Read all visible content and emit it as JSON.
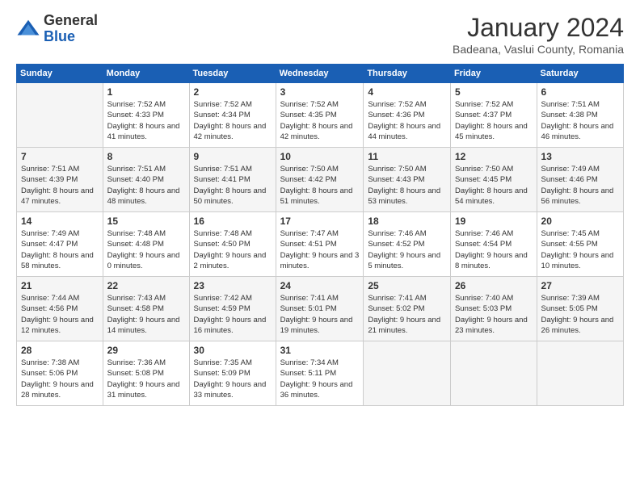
{
  "header": {
    "logo": {
      "general": "General",
      "blue": "Blue"
    },
    "title": "January 2024",
    "location": "Badeana, Vaslui County, Romania"
  },
  "weekdays": [
    "Sunday",
    "Monday",
    "Tuesday",
    "Wednesday",
    "Thursday",
    "Friday",
    "Saturday"
  ],
  "weeks": [
    [
      {
        "day": "",
        "sunrise": "",
        "sunset": "",
        "daylight": ""
      },
      {
        "day": "1",
        "sunrise": "Sunrise: 7:52 AM",
        "sunset": "Sunset: 4:33 PM",
        "daylight": "Daylight: 8 hours and 41 minutes."
      },
      {
        "day": "2",
        "sunrise": "Sunrise: 7:52 AM",
        "sunset": "Sunset: 4:34 PM",
        "daylight": "Daylight: 8 hours and 42 minutes."
      },
      {
        "day": "3",
        "sunrise": "Sunrise: 7:52 AM",
        "sunset": "Sunset: 4:35 PM",
        "daylight": "Daylight: 8 hours and 42 minutes."
      },
      {
        "day": "4",
        "sunrise": "Sunrise: 7:52 AM",
        "sunset": "Sunset: 4:36 PM",
        "daylight": "Daylight: 8 hours and 44 minutes."
      },
      {
        "day": "5",
        "sunrise": "Sunrise: 7:52 AM",
        "sunset": "Sunset: 4:37 PM",
        "daylight": "Daylight: 8 hours and 45 minutes."
      },
      {
        "day": "6",
        "sunrise": "Sunrise: 7:51 AM",
        "sunset": "Sunset: 4:38 PM",
        "daylight": "Daylight: 8 hours and 46 minutes."
      }
    ],
    [
      {
        "day": "7",
        "sunrise": "Sunrise: 7:51 AM",
        "sunset": "Sunset: 4:39 PM",
        "daylight": "Daylight: 8 hours and 47 minutes."
      },
      {
        "day": "8",
        "sunrise": "Sunrise: 7:51 AM",
        "sunset": "Sunset: 4:40 PM",
        "daylight": "Daylight: 8 hours and 48 minutes."
      },
      {
        "day": "9",
        "sunrise": "Sunrise: 7:51 AM",
        "sunset": "Sunset: 4:41 PM",
        "daylight": "Daylight: 8 hours and 50 minutes."
      },
      {
        "day": "10",
        "sunrise": "Sunrise: 7:50 AM",
        "sunset": "Sunset: 4:42 PM",
        "daylight": "Daylight: 8 hours and 51 minutes."
      },
      {
        "day": "11",
        "sunrise": "Sunrise: 7:50 AM",
        "sunset": "Sunset: 4:43 PM",
        "daylight": "Daylight: 8 hours and 53 minutes."
      },
      {
        "day": "12",
        "sunrise": "Sunrise: 7:50 AM",
        "sunset": "Sunset: 4:45 PM",
        "daylight": "Daylight: 8 hours and 54 minutes."
      },
      {
        "day": "13",
        "sunrise": "Sunrise: 7:49 AM",
        "sunset": "Sunset: 4:46 PM",
        "daylight": "Daylight: 8 hours and 56 minutes."
      }
    ],
    [
      {
        "day": "14",
        "sunrise": "Sunrise: 7:49 AM",
        "sunset": "Sunset: 4:47 PM",
        "daylight": "Daylight: 8 hours and 58 minutes."
      },
      {
        "day": "15",
        "sunrise": "Sunrise: 7:48 AM",
        "sunset": "Sunset: 4:48 PM",
        "daylight": "Daylight: 9 hours and 0 minutes."
      },
      {
        "day": "16",
        "sunrise": "Sunrise: 7:48 AM",
        "sunset": "Sunset: 4:50 PM",
        "daylight": "Daylight: 9 hours and 2 minutes."
      },
      {
        "day": "17",
        "sunrise": "Sunrise: 7:47 AM",
        "sunset": "Sunset: 4:51 PM",
        "daylight": "Daylight: 9 hours and 3 minutes."
      },
      {
        "day": "18",
        "sunrise": "Sunrise: 7:46 AM",
        "sunset": "Sunset: 4:52 PM",
        "daylight": "Daylight: 9 hours and 5 minutes."
      },
      {
        "day": "19",
        "sunrise": "Sunrise: 7:46 AM",
        "sunset": "Sunset: 4:54 PM",
        "daylight": "Daylight: 9 hours and 8 minutes."
      },
      {
        "day": "20",
        "sunrise": "Sunrise: 7:45 AM",
        "sunset": "Sunset: 4:55 PM",
        "daylight": "Daylight: 9 hours and 10 minutes."
      }
    ],
    [
      {
        "day": "21",
        "sunrise": "Sunrise: 7:44 AM",
        "sunset": "Sunset: 4:56 PM",
        "daylight": "Daylight: 9 hours and 12 minutes."
      },
      {
        "day": "22",
        "sunrise": "Sunrise: 7:43 AM",
        "sunset": "Sunset: 4:58 PM",
        "daylight": "Daylight: 9 hours and 14 minutes."
      },
      {
        "day": "23",
        "sunrise": "Sunrise: 7:42 AM",
        "sunset": "Sunset: 4:59 PM",
        "daylight": "Daylight: 9 hours and 16 minutes."
      },
      {
        "day": "24",
        "sunrise": "Sunrise: 7:41 AM",
        "sunset": "Sunset: 5:01 PM",
        "daylight": "Daylight: 9 hours and 19 minutes."
      },
      {
        "day": "25",
        "sunrise": "Sunrise: 7:41 AM",
        "sunset": "Sunset: 5:02 PM",
        "daylight": "Daylight: 9 hours and 21 minutes."
      },
      {
        "day": "26",
        "sunrise": "Sunrise: 7:40 AM",
        "sunset": "Sunset: 5:03 PM",
        "daylight": "Daylight: 9 hours and 23 minutes."
      },
      {
        "day": "27",
        "sunrise": "Sunrise: 7:39 AM",
        "sunset": "Sunset: 5:05 PM",
        "daylight": "Daylight: 9 hours and 26 minutes."
      }
    ],
    [
      {
        "day": "28",
        "sunrise": "Sunrise: 7:38 AM",
        "sunset": "Sunset: 5:06 PM",
        "daylight": "Daylight: 9 hours and 28 minutes."
      },
      {
        "day": "29",
        "sunrise": "Sunrise: 7:36 AM",
        "sunset": "Sunset: 5:08 PM",
        "daylight": "Daylight: 9 hours and 31 minutes."
      },
      {
        "day": "30",
        "sunrise": "Sunrise: 7:35 AM",
        "sunset": "Sunset: 5:09 PM",
        "daylight": "Daylight: 9 hours and 33 minutes."
      },
      {
        "day": "31",
        "sunrise": "Sunrise: 7:34 AM",
        "sunset": "Sunset: 5:11 PM",
        "daylight": "Daylight: 9 hours and 36 minutes."
      },
      {
        "day": "",
        "sunrise": "",
        "sunset": "",
        "daylight": ""
      },
      {
        "day": "",
        "sunrise": "",
        "sunset": "",
        "daylight": ""
      },
      {
        "day": "",
        "sunrise": "",
        "sunset": "",
        "daylight": ""
      }
    ]
  ]
}
